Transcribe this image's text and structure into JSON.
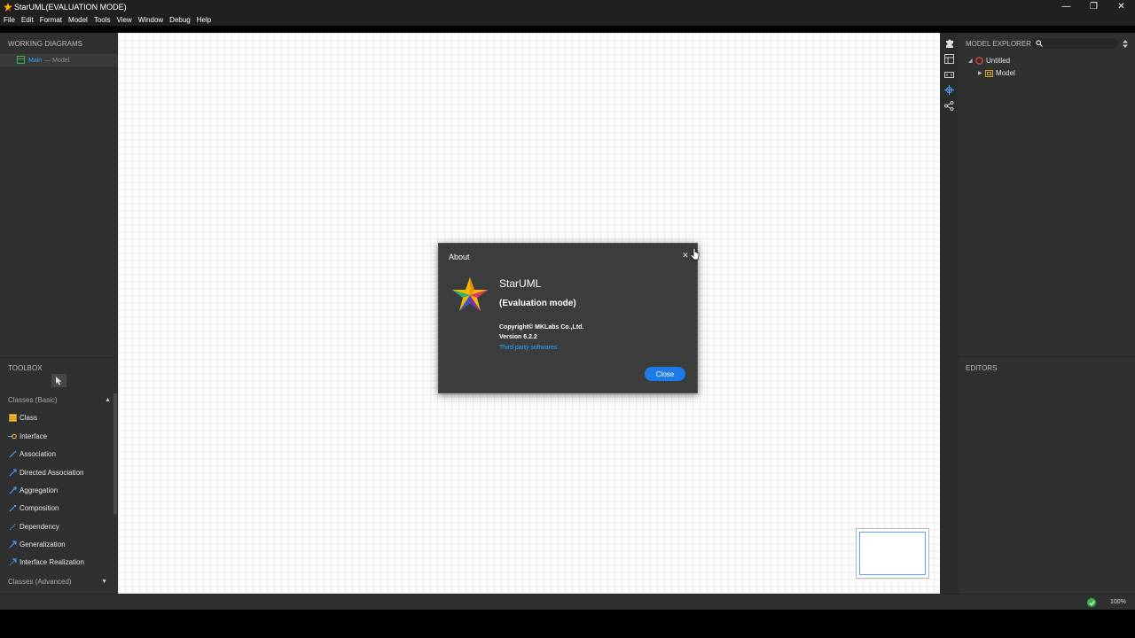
{
  "window": {
    "title": "StarUML(EVALUATION MODE)",
    "controls": [
      "—",
      "❐",
      "✕"
    ]
  },
  "menu": [
    "File",
    "Edit",
    "Format",
    "Model",
    "Tools",
    "View",
    "Window",
    "Debug",
    "Help"
  ],
  "working_diagrams": {
    "header": "WORKING DIAGRAMS",
    "items": [
      {
        "name": "Main",
        "sub": "— Model"
      }
    ]
  },
  "toolbox": {
    "header": "TOOLBOX",
    "groups": [
      {
        "label": "Classes (Basic)",
        "state": "expanded"
      },
      {
        "label": "Classes (Advanced)",
        "state": "collapsed"
      }
    ],
    "items": [
      {
        "label": "Class",
        "icon": "class-icon"
      },
      {
        "label": "Interface",
        "icon": "interface-icon"
      },
      {
        "label": "Association",
        "icon": "association-icon"
      },
      {
        "label": "Directed Association",
        "icon": "directed-association-icon"
      },
      {
        "label": "Aggregation",
        "icon": "aggregation-icon"
      },
      {
        "label": "Composition",
        "icon": "composition-icon"
      },
      {
        "label": "Dependency",
        "icon": "dependency-icon"
      },
      {
        "label": "Generalization",
        "icon": "generalization-icon"
      },
      {
        "label": "Interface Realization",
        "icon": "interface-realization-icon"
      }
    ]
  },
  "model_explorer": {
    "header": "MODEL EXPLORER",
    "search_placeholder": "",
    "tree": [
      {
        "label": "Untitled",
        "level": 0,
        "expanded": true,
        "icon": "project-icon"
      },
      {
        "label": "Model",
        "level": 1,
        "expanded": false,
        "icon": "model-package-icon"
      }
    ]
  },
  "editors": {
    "header": "EDITORS"
  },
  "status": {
    "zoom": "100%",
    "ok": true
  },
  "about_dialog": {
    "title": "About",
    "app_name": "StarUML",
    "mode": "(Evaluation mode)",
    "copyright": "Copyright© MKLabs Co.,Ltd.",
    "version": "Version 6.2.2",
    "link": "Third party softwares",
    "close_label": "Close"
  },
  "colors": {
    "accent": "#1e7ae8",
    "link": "#2aa7ff",
    "panel": "#2f3030",
    "canvas": "#fdfdfd"
  }
}
